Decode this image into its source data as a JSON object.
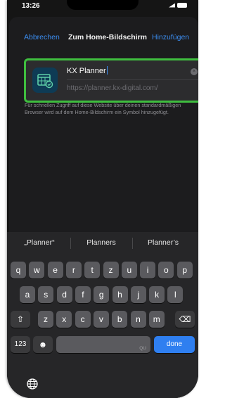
{
  "status_bar": {
    "time": "13:26"
  },
  "nav": {
    "cancel_label": "Abbrechen",
    "title": "Zum Home-Bildschirm",
    "add_label": "Hinzufügen"
  },
  "card": {
    "app_name": "KX Planner",
    "url": "https://planner.kx-digital.com/",
    "clear_icon": "×",
    "icon_name": "calendar-check-icon"
  },
  "hint_text": "Für schnellen Zugriff auf diese Website über deinen standardmäßigen Browser wird auf dem Home-Bildschirm ein Symbol hinzugefügt.",
  "keyboard": {
    "suggestions": [
      "„Planner“",
      "Planners",
      "Planner’s"
    ],
    "row1": [
      "q",
      "w",
      "e",
      "r",
      "t",
      "z",
      "u",
      "i",
      "o",
      "p"
    ],
    "row2": [
      "a",
      "s",
      "d",
      "f",
      "g",
      "h",
      "j",
      "k",
      "l"
    ],
    "row3": [
      "z",
      "x",
      "c",
      "v",
      "b",
      "n",
      "m"
    ],
    "shift_symbol": "⇧",
    "delete_symbol": "⌫",
    "numbers_label": "123",
    "emoji_symbol": "☻",
    "space_sub_label": "QU",
    "done_label": "done",
    "globe_icon": "globe-icon"
  },
  "colors": {
    "accent": "#3b8df0",
    "highlight_border": "#3fbe3f",
    "done_key": "#2f7ff0"
  }
}
